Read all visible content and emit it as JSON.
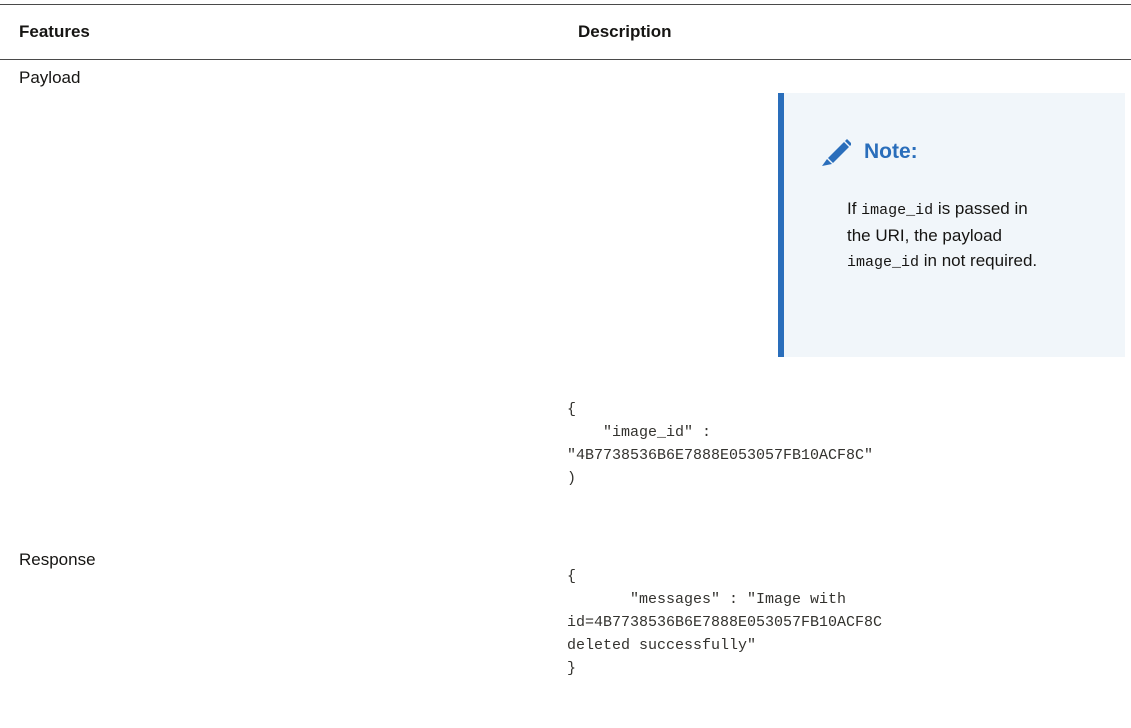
{
  "table": {
    "headers": {
      "features": "Features",
      "description": "Description"
    },
    "rows": [
      {
        "feature": "Payload",
        "note": {
          "title": "Note:",
          "body_parts": [
            "If ",
            "image_id",
            " is passed in the URI, the payload ",
            "image_id",
            " in not required."
          ]
        },
        "code": "{\n    \"image_id\" :\n\"4B7738536B6E7888E053057FB10ACF8C\"\n)"
      },
      {
        "feature": "Response",
        "code": "{\n       \"messages\" : \"Image with\nid=4B7738536B6E7888E053057FB10ACF8C\ndeleted successfully\"\n}"
      }
    ]
  },
  "colors": {
    "note_accent": "#2a6ebb",
    "note_background": "#f1f6fa"
  },
  "icons": {
    "note_icon": "pencil-icon"
  }
}
